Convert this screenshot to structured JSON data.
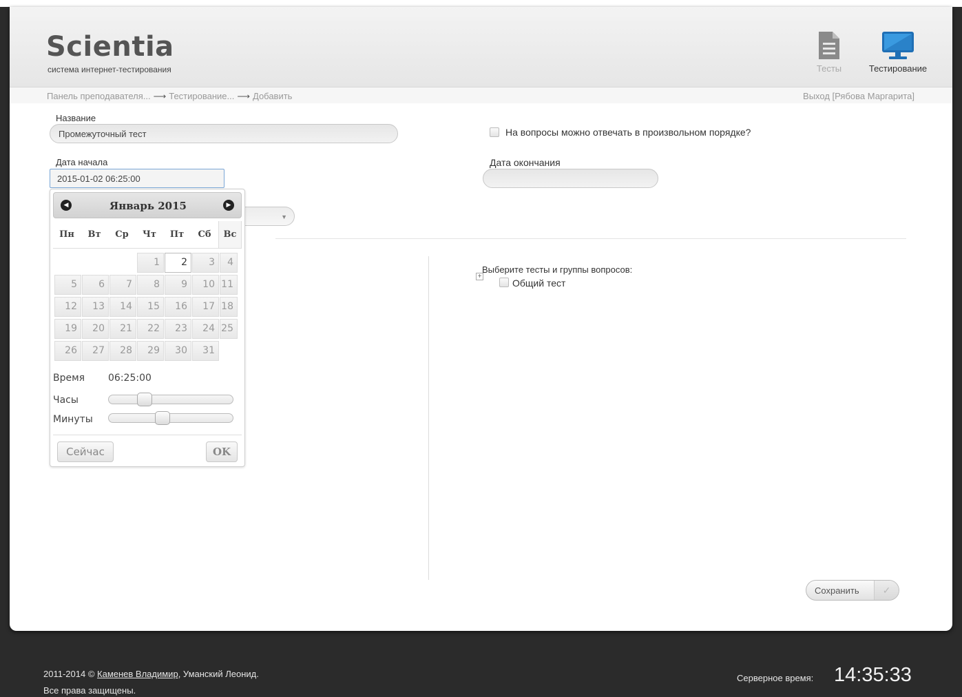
{
  "header": {
    "logo_title": "Scientia",
    "logo_subtitle": "система интернет-тестирования",
    "nav": [
      {
        "label": "Тесты",
        "icon": "document-icon"
      },
      {
        "label": "Тестирование",
        "icon": "monitor-icon"
      }
    ]
  },
  "breadcrumb": {
    "items": [
      "Панель преподавателя...",
      "Тестирование...",
      "Добавить"
    ],
    "separator": "⟶"
  },
  "logout": {
    "label": "Выход [Рябова Маргарита]"
  },
  "form": {
    "name_label": "Название",
    "name_value": "Промежуточный тест",
    "start_label": "Дата начала",
    "start_value": "2015-01-02 06:25:00",
    "end_label": "Дата окончания",
    "end_value": "",
    "random_order_label": "На вопросы можно отвечать в произвольном порядке?",
    "random_order_checked": false,
    "tests_label": "Выберите тесты и группы вопросов:",
    "tree_item": "Общий тест",
    "save_label": "Сохранить"
  },
  "datepicker": {
    "month": "Январь 2015",
    "weekdays": [
      "Пн",
      "Вт",
      "Ср",
      "Чт",
      "Пт",
      "Сб",
      "Вс"
    ],
    "weeks": [
      [
        "",
        "",
        "",
        "1",
        "2",
        "3",
        "4"
      ],
      [
        "5",
        "6",
        "7",
        "8",
        "9",
        "10",
        "11"
      ],
      [
        "12",
        "13",
        "14",
        "15",
        "16",
        "17",
        "18"
      ],
      [
        "19",
        "20",
        "21",
        "22",
        "23",
        "24",
        "25"
      ],
      [
        "26",
        "27",
        "28",
        "29",
        "30",
        "31",
        ""
      ]
    ],
    "selected_day": "2",
    "time_label": "Время",
    "time_value": "06:25:00",
    "hours_label": "Часы",
    "minutes_label": "Минуты",
    "hours": 6,
    "minutes": 25,
    "now_label": "Сейчас",
    "ok_label": "OK"
  },
  "footer": {
    "copyright_prefix": "2011-2014 © ",
    "author_link": "Каменев Владимир",
    "copyright_suffix": ", Уманский Леонид.",
    "rights": "Все права защищены.",
    "server_time_label": "Серверное время:",
    "server_time": "14:35:33"
  },
  "colors": {
    "accent_blue": "#2a7fc4",
    "footer_bg": "#2b2b2b"
  }
}
